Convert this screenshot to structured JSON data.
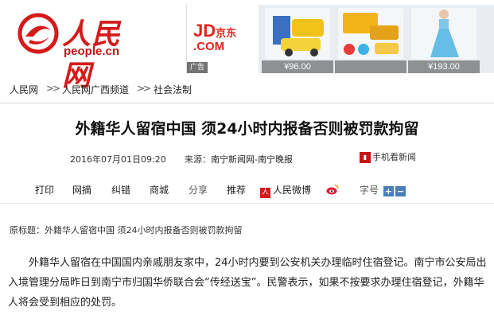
{
  "logo": {
    "cn": "人民网",
    "url": "people.cn"
  },
  "ad": {
    "brand": "JD",
    "brand_cn": "京东",
    "brand_domain": ".COM",
    "tag": "广告",
    "products": [
      {
        "price": "¥96.00"
      },
      {
        "price": ""
      },
      {
        "price": "¥193.00"
      }
    ]
  },
  "breadcrumb": {
    "items": [
      "人民网",
      "人民网广西频道",
      "社会法制"
    ],
    "separator": ">>"
  },
  "article": {
    "title": "外籍华人留宿中国 须24小时内报备否则被罚款拘留",
    "date": "2016年07月01日09:20",
    "source_label": "来源：",
    "source": "南宁新闻网-南宁晚报",
    "mobile_label": "手机看新闻",
    "subtitle": "原标题：外籍华人留宿中国 须24小时内报备否则被罚款拘留",
    "paragraph": "外籍华人留宿在中国国内亲戚朋友家中，24小时内要到公安机关办理临时住宿登记。南宁市公安局出入境管理分局昨日到南宁市归国华侨联合会“传经送宝”。民警表示，如果不按要求办理住宿登记，外籍华人将会受到相应的处罚。"
  },
  "toolbar": {
    "print": "打印",
    "net_excerpt": "网摘",
    "correction": "纠错",
    "mall": "商城",
    "share": "分享",
    "recommend": "推荐",
    "weibo": "人民微博",
    "font_size": "字号",
    "plus": "+",
    "minus": "−"
  },
  "colors": {
    "brand_red": "#d51a1a",
    "jd_red": "#e1251b",
    "font_btn": "#4b7fb8"
  }
}
